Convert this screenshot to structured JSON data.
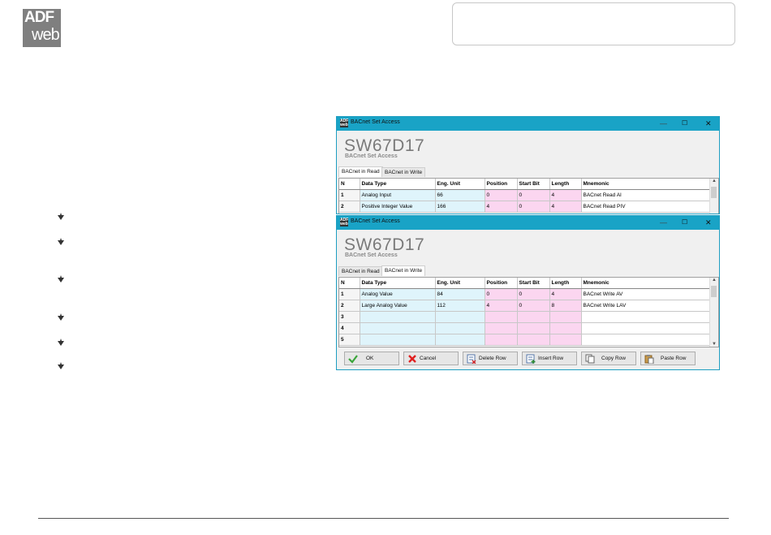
{
  "logo": {
    "line1": "ADF",
    "line2": "web"
  },
  "windows": [
    {
      "title": "BACnet Set Access",
      "window_controls": {
        "minimize": "—",
        "maximize": "☐",
        "close": "✕"
      },
      "product_name": "SW67D17",
      "product_subtitle": "BACnet Set Access",
      "tabs": [
        {
          "label": "BACnet in Read",
          "active": true
        },
        {
          "label": "BACnet in Write",
          "active": false
        }
      ],
      "columns": [
        "N",
        "Data Type",
        "Eng. Unit",
        "Position",
        "Start Bit",
        "Length",
        "Mnemonic"
      ],
      "rows": [
        [
          "1",
          "Analog Input",
          "66",
          "0",
          "0",
          "4",
          "BACnet Read AI"
        ],
        [
          "2",
          "Positive Integer Value",
          "166",
          "4",
          "0",
          "4",
          "BACnet Read PIV"
        ]
      ]
    },
    {
      "title": "BACnet Set Access",
      "window_controls": {
        "minimize": "—",
        "maximize": "☐",
        "close": "✕"
      },
      "product_name": "SW67D17",
      "product_subtitle": "BACnet Set Access",
      "tabs": [
        {
          "label": "BACnet in Read",
          "active": false
        },
        {
          "label": "BACnet in Write",
          "active": true
        }
      ],
      "columns": [
        "N",
        "Data Type",
        "Eng. Unit",
        "Position",
        "Start Bit",
        "Length",
        "Mnemonic"
      ],
      "rows": [
        [
          "1",
          "Analog Value",
          "84",
          "0",
          "0",
          "4",
          "BACnet Write AV"
        ],
        [
          "2",
          "Large Analog Value",
          "112",
          "4",
          "0",
          "8",
          "BACnet Write LAV"
        ],
        [
          "3",
          "",
          "",
          "",
          "",
          "",
          ""
        ],
        [
          "4",
          "",
          "",
          "",
          "",
          "",
          ""
        ],
        [
          "5",
          "",
          "",
          "",
          "",
          "",
          ""
        ]
      ],
      "buttons": [
        {
          "label": "OK",
          "icon": "check-icon"
        },
        {
          "label": "Cancel",
          "icon": "x-icon"
        },
        {
          "label": "Delete Row",
          "icon": "delete-row-icon"
        },
        {
          "label": "Insert Row",
          "icon": "insert-row-icon"
        },
        {
          "label": "Copy Row",
          "icon": "copy-icon"
        },
        {
          "label": "Paste Row",
          "icon": "paste-icon"
        }
      ]
    }
  ],
  "colors": {
    "titlebar": "#19a3c6",
    "blue_cell": "#dff4fb",
    "pink_cell": "#fbd6f0"
  }
}
